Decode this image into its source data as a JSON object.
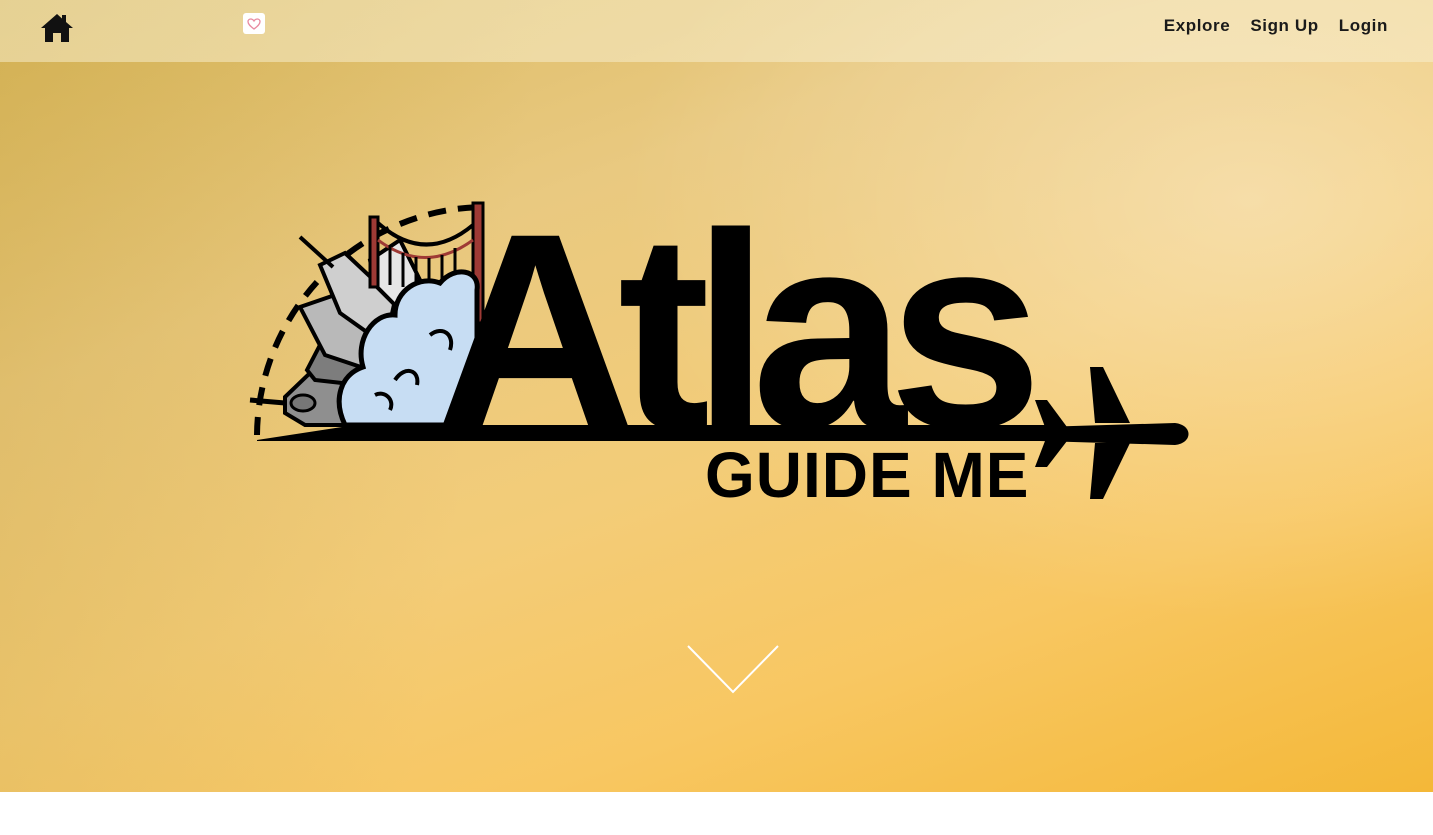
{
  "navbar": {
    "home_icon": "home-icon",
    "favorite_icon": "heart-icon",
    "links": [
      {
        "label": "Explore"
      },
      {
        "label": "Sign Up"
      },
      {
        "label": "Login"
      }
    ]
  },
  "hero": {
    "logo": {
      "word": "Atlas",
      "tagline": "GUIDE ME",
      "icons": [
        "city-skyline-icon",
        "golden-gate-bridge-icon",
        "cloud-icon",
        "airplane-icon"
      ]
    },
    "scroll_icon": "chevron-down-icon",
    "colors": {
      "gradient_start": "#d9b961",
      "gradient_mid": "#f3cc78",
      "gradient_end": "#f4b838",
      "cloud": "#c7ddf3",
      "bridge": "#9e3a35"
    }
  }
}
